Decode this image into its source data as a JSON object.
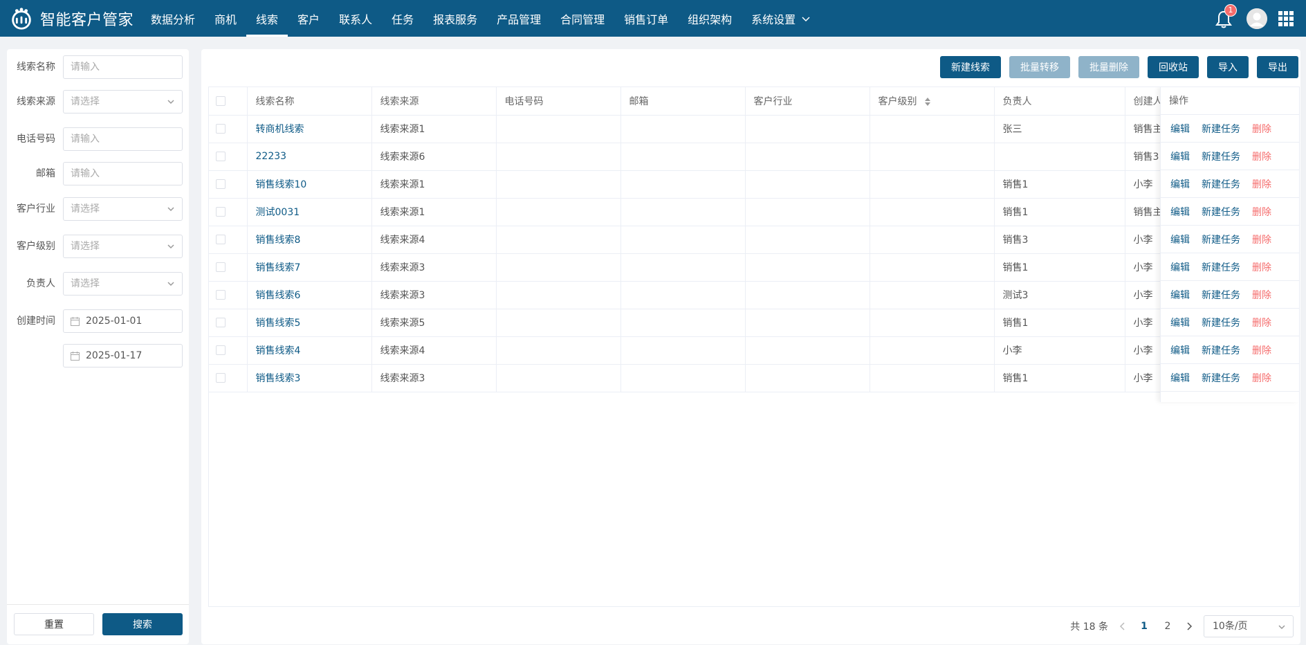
{
  "app": {
    "title": "智能客户管家",
    "colors": {
      "primary": "#0e5a86",
      "danger": "#f56c6c",
      "disabled": "#8fb3c9"
    }
  },
  "nav": {
    "items": [
      {
        "label": "数据分析",
        "active": false
      },
      {
        "label": "商机",
        "active": false
      },
      {
        "label": "线索",
        "active": true
      },
      {
        "label": "客户",
        "active": false
      },
      {
        "label": "联系人",
        "active": false
      },
      {
        "label": "任务",
        "active": false
      },
      {
        "label": "报表服务",
        "active": false
      },
      {
        "label": "产品管理",
        "active": false
      },
      {
        "label": "合同管理",
        "active": false
      },
      {
        "label": "销售订单",
        "active": false
      },
      {
        "label": "组织架构",
        "active": false
      },
      {
        "label": "系统设置",
        "active": false
      }
    ],
    "notification_count": "1"
  },
  "filters": {
    "lead_name": {
      "label": "线索名称",
      "placeholder": "请输入"
    },
    "lead_source": {
      "label": "线索来源",
      "placeholder": "请选择"
    },
    "phone": {
      "label": "电话号码",
      "placeholder": "请输入"
    },
    "email": {
      "label": "邮箱",
      "placeholder": "请输入"
    },
    "industry": {
      "label": "客户行业",
      "placeholder": "请选择"
    },
    "level": {
      "label": "客户级别",
      "placeholder": "请选择"
    },
    "owner": {
      "label": "负责人",
      "placeholder": "请选择"
    },
    "created": {
      "label": "创建时间",
      "start": "2025-01-01",
      "end": "2025-01-17"
    },
    "reset_label": "重置",
    "search_label": "搜索"
  },
  "toolbar": {
    "new_lead": "新建线索",
    "batch_transfer": "批量转移",
    "batch_delete": "批量删除",
    "recycle_bin": "回收站",
    "import": "导入",
    "export": "导出"
  },
  "table": {
    "columns": [
      "线索名称",
      "线索来源",
      "电话号码",
      "邮箱",
      "客户行业",
      "客户级别",
      "负责人",
      "创建人"
    ],
    "ops_header": "操作",
    "ops": {
      "edit": "编辑",
      "new_task": "新建任务",
      "delete": "删除"
    },
    "rows": [
      [
        "转商机线索",
        "线索来源1",
        "",
        "",
        "",
        "",
        "张三",
        "销售主"
      ],
      [
        "22233",
        "线索来源6",
        "",
        "",
        "",
        "",
        "",
        "销售3"
      ],
      [
        "销售线索10",
        "线索来源1",
        "",
        "",
        "",
        "",
        "销售1",
        "小李"
      ],
      [
        "测试0031",
        "线索来源1",
        "",
        "",
        "",
        "",
        "销售1",
        "销售主"
      ],
      [
        "销售线索8",
        "线索来源4",
        "",
        "",
        "",
        "",
        "销售3",
        "小李"
      ],
      [
        "销售线索7",
        "线索来源3",
        "",
        "",
        "",
        "",
        "销售1",
        "小李"
      ],
      [
        "销售线索6",
        "线索来源3",
        "",
        "",
        "",
        "",
        "测试3",
        "小李"
      ],
      [
        "销售线索5",
        "线索来源5",
        "",
        "",
        "",
        "",
        "销售1",
        "小李"
      ],
      [
        "销售线索4",
        "线索来源4",
        "",
        "",
        "",
        "",
        "小李",
        "小李"
      ],
      [
        "销售线索3",
        "线索来源3",
        "",
        "",
        "",
        "",
        "销售1",
        "小李"
      ]
    ]
  },
  "pagination": {
    "total_text": "共 18 条",
    "pages": [
      "1",
      "2"
    ],
    "current": "1",
    "page_size": "10条/页"
  }
}
